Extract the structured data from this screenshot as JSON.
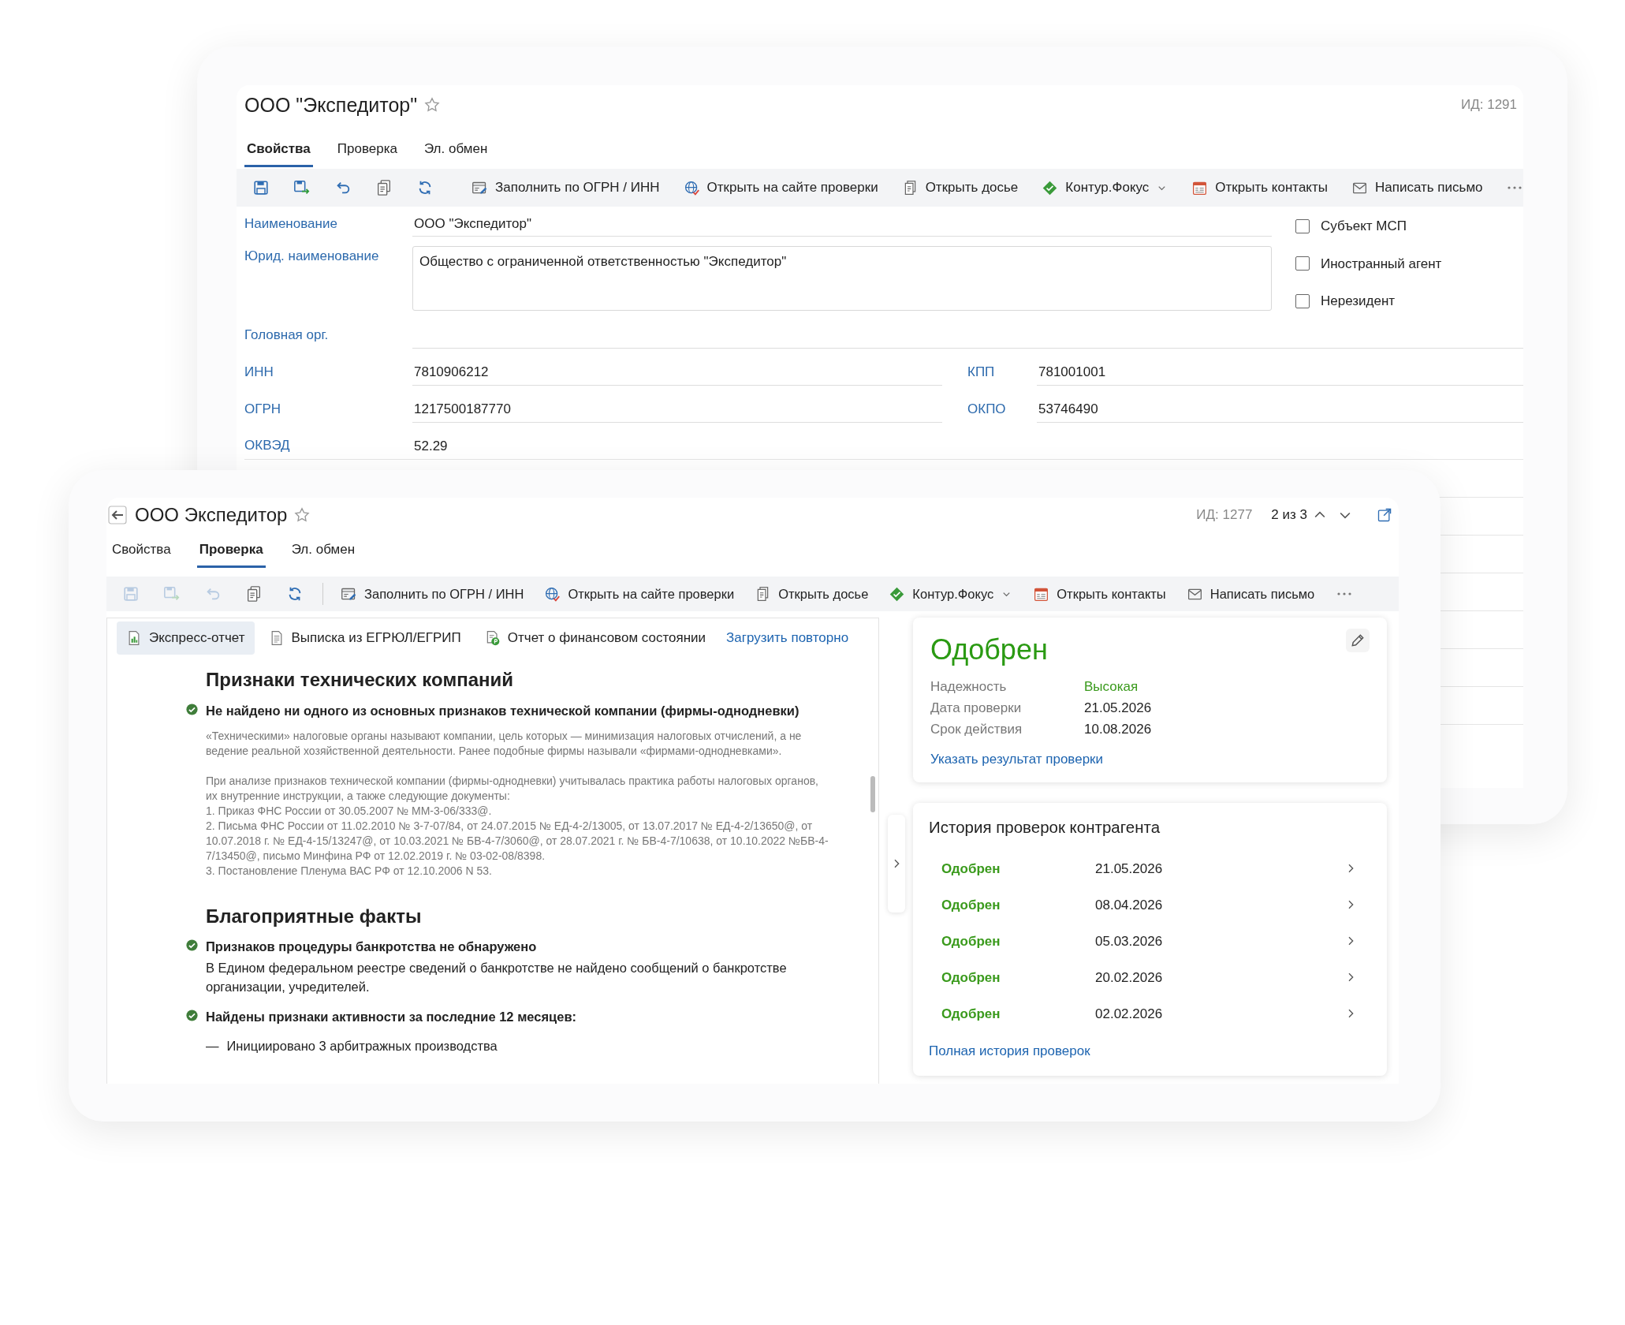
{
  "back_window": {
    "title": "ООО \"Экспедитор\"",
    "id_label": "ИД: 1291",
    "tabs": [
      {
        "label": "Свойства",
        "selected": true
      },
      {
        "label": "Проверка",
        "selected": false
      },
      {
        "label": "Эл. обмен",
        "selected": false
      }
    ],
    "toolbar": {
      "tools": [
        {
          "kind": "save",
          "disabled": false
        },
        {
          "kind": "save_as",
          "disabled": false
        },
        {
          "kind": "undo",
          "disabled": false
        },
        {
          "kind": "copy",
          "disabled": false
        },
        {
          "kind": "refresh",
          "disabled": false
        }
      ],
      "actions": [
        {
          "kind": "fill",
          "label": "Заполнить по ОГРН / ИНН",
          "dropdown": false
        },
        {
          "kind": "site",
          "label": "Открыть на сайте проверки",
          "dropdown": false
        },
        {
          "kind": "dossier",
          "label": "Открыть досье",
          "dropdown": false
        },
        {
          "kind": "focus",
          "label": "Контур.Фокус",
          "dropdown": true
        },
        {
          "kind": "contacts",
          "label": "Открыть контакты",
          "dropdown": false
        },
        {
          "kind": "mail",
          "label": "Написать письмо",
          "dropdown": false
        }
      ]
    },
    "form": {
      "name": {
        "label": "Наименование",
        "value": "ООО \"Экспедитор\""
      },
      "legal_name": {
        "label": "Юрид. наименование",
        "value": "Общество с ограниченной ответственностью \"Экспедитор\""
      },
      "flags": [
        {
          "label": "Субъект МСП",
          "checked": false
        },
        {
          "label": "Иностранный агент",
          "checked": false
        },
        {
          "label": "Нерезидент",
          "checked": false
        }
      ],
      "head_org": {
        "label": "Головная орг."
      },
      "pairs": [
        [
          {
            "label": "ИНН",
            "value": "7810906212"
          },
          {
            "label": "КПП",
            "value": "781001001"
          }
        ],
        [
          {
            "label": "ОГРН",
            "value": "1217500187770"
          },
          {
            "label": "ОКПО",
            "value": "53746490"
          }
        ]
      ],
      "okved": {
        "label": "ОКВЭД",
        "value": "52.29"
      }
    }
  },
  "front_window": {
    "title": "ООО Экспедитор",
    "id_label": "ИД: 1277",
    "position": "2 из 3",
    "tabs": [
      {
        "label": "Свойства",
        "selected": false
      },
      {
        "label": "Проверка",
        "selected": true
      },
      {
        "label": "Эл. обмен",
        "selected": false
      }
    ],
    "toolbar": {
      "tools": [
        {
          "kind": "save",
          "disabled": true
        },
        {
          "kind": "save_as",
          "disabled": true
        },
        {
          "kind": "undo",
          "disabled": true
        },
        {
          "kind": "copy",
          "disabled": false
        },
        {
          "kind": "refresh",
          "disabled": false
        }
      ],
      "actions": [
        {
          "kind": "fill",
          "label": "Заполнить по ОГРН / ИНН",
          "dropdown": false
        },
        {
          "kind": "site",
          "label": "Открыть на сайте проверки",
          "dropdown": false
        },
        {
          "kind": "dossier",
          "label": "Открыть досье",
          "dropdown": false
        },
        {
          "kind": "focus",
          "label": "Контур.Фокус",
          "dropdown": true
        },
        {
          "kind": "contacts",
          "label": "Открыть контакты",
          "dropdown": false
        },
        {
          "kind": "mail",
          "label": "Написать письмо",
          "dropdown": false
        }
      ]
    },
    "report_tabs": [
      {
        "kind": "express",
        "label": "Экспресс-отчет",
        "selected": true
      },
      {
        "kind": "extract",
        "label": "Выписка из ЕГРЮЛ/ЕГРИП",
        "selected": false
      },
      {
        "kind": "finance",
        "label": "Отчет о финансовом состоянии",
        "selected": false
      }
    ],
    "reload_link": "Загрузить повторно",
    "sections": [
      {
        "heading": "Признаки технических компаний",
        "items": [
          {
            "kind": "check",
            "title": "Не найдено ни одного из основных признаков технической компании (фирмы-однодневки)",
            "notes": [
              [
                "«Техническими» налоговые органы называют компании, цель которых — минимизация налоговых отчислений, а не ведение реальной хозяйственной деятельности. Ранее подобные фирмы называли «фирмами-однодневками»."
              ],
              [
                "При анализе признаков технической компании (фирмы-однодневки) учитывалась практика работы налоговых органов, их внутренние инструкции, а также следующие документы:",
                "1. Приказ ФНС России от 30.05.2007 № ММ-3-06/333@.",
                "2. Письма ФНС России от 11.02.2010 № 3-7-07/84, от 24.07.2015 № ЕД-4-2/13005, от 13.07.2017 № ЕД-4-2/13650@, от 10.07.2018 г. № ЕД-4-15/13247@, от 10.03.2021 № БВ-4-7/3060@, от 28.07.2021 г. № БВ-4-7/10638, от 10.10.2022 №БВ-4-7/13450@, письмо Минфина РФ от 12.02.2019 г. № 03-02-08/8398.",
                "3. Постановление Пленума ВАС РФ от 12.10.2006 N 53."
              ]
            ]
          }
        ]
      },
      {
        "heading": "Благоприятные факты",
        "items": [
          {
            "kind": "check",
            "title": "Признаков процедуры банкротства не обнаружено",
            "text": "В Едином федеральном реестре сведений о банкротстве не найдено сообщений о банкротстве организации, учредителей."
          },
          {
            "kind": "check",
            "title": "Найдены признаки активности за последние 12 месяцев:",
            "bullets": [
              {
                "marker": "—",
                "text": "Инициировано 3 арбитражных производства"
              }
            ]
          }
        ]
      }
    ],
    "status_card": {
      "status": "Одобрен",
      "fields": [
        {
          "label": "Надежность",
          "value": "Высокая",
          "kind": "rating"
        },
        {
          "label": "Дата проверки",
          "value": "21.05.2026",
          "kind": "date"
        },
        {
          "label": "Срок действия",
          "value": "10.08.2026",
          "kind": "date"
        }
      ],
      "link": "Указать результат проверки"
    },
    "history": {
      "title": "История проверок контрагента",
      "rows": [
        {
          "status": "Одобрен",
          "date": "21.05.2026"
        },
        {
          "status": "Одобрен",
          "date": "08.04.2026"
        },
        {
          "status": "Одобрен",
          "date": "05.03.2026"
        },
        {
          "status": "Одобрен",
          "date": "20.02.2026"
        },
        {
          "status": "Одобрен",
          "date": "02.02.2026"
        }
      ],
      "link": "Полная история проверок"
    }
  }
}
